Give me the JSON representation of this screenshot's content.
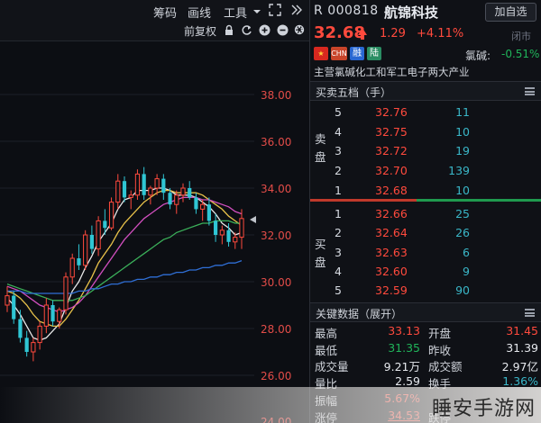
{
  "toolbar": {
    "chips_label": "筹码",
    "drawing_label": "画线",
    "tools_label": "工具",
    "adjust_label": "前复权"
  },
  "price_axis": [
    "38.00",
    "36.00",
    "34.00",
    "32.00",
    "30.00",
    "28.00",
    "26.00",
    "24.00"
  ],
  "chart_data": {
    "type": "candlestick",
    "title": "",
    "ylim": [
      24.5,
      39
    ],
    "yticks": [
      26,
      28,
      30,
      32,
      34,
      36,
      38
    ],
    "candles": [
      [
        29.0,
        29.8,
        28.7,
        29.4
      ],
      [
        29.4,
        29.6,
        28.2,
        28.4
      ],
      [
        28.4,
        28.8,
        27.4,
        27.6
      ],
      [
        27.6,
        27.9,
        26.8,
        27.0
      ],
      [
        27.0,
        27.6,
        26.6,
        27.4
      ],
      [
        27.4,
        28.3,
        27.1,
        28.1
      ],
      [
        28.1,
        29.3,
        27.8,
        29.0
      ],
      [
        29.0,
        29.2,
        28.1,
        28.3
      ],
      [
        28.3,
        28.9,
        28.0,
        28.8
      ],
      [
        28.8,
        30.4,
        28.6,
        30.2
      ],
      [
        30.2,
        31.2,
        29.9,
        31.0
      ],
      [
        31.0,
        31.6,
        30.5,
        30.7
      ],
      [
        30.7,
        32.2,
        30.5,
        32.0
      ],
      [
        32.0,
        32.4,
        31.2,
        31.4
      ],
      [
        31.4,
        32.8,
        31.1,
        32.6
      ],
      [
        32.6,
        33.1,
        32.0,
        32.3
      ],
      [
        32.3,
        33.6,
        32.2,
        33.4
      ],
      [
        33.4,
        34.6,
        33.1,
        34.3
      ],
      [
        34.3,
        34.5,
        33.4,
        33.6
      ],
      [
        33.6,
        33.9,
        33.1,
        33.7
      ],
      [
        33.7,
        34.8,
        33.5,
        34.6
      ],
      [
        34.6,
        34.9,
        33.5,
        33.7
      ],
      [
        33.7,
        34.1,
        33.3,
        34.0
      ],
      [
        34.0,
        34.6,
        33.7,
        34.4
      ],
      [
        34.4,
        34.6,
        33.5,
        33.8
      ],
      [
        33.8,
        34.0,
        33.1,
        33.3
      ],
      [
        33.3,
        33.9,
        32.9,
        33.7
      ],
      [
        33.7,
        34.2,
        33.4,
        34.0
      ],
      [
        34.0,
        34.3,
        33.5,
        33.6
      ],
      [
        33.6,
        33.8,
        32.9,
        33.1
      ],
      [
        33.1,
        33.5,
        32.6,
        33.3
      ],
      [
        33.3,
        33.6,
        32.4,
        32.6
      ],
      [
        32.6,
        32.9,
        31.7,
        32.0
      ],
      [
        32.0,
        32.4,
        31.6,
        32.2
      ],
      [
        32.2,
        32.5,
        31.5,
        31.7
      ],
      [
        31.7,
        32.1,
        31.4,
        31.9
      ],
      [
        31.9,
        33.1,
        31.4,
        32.7
      ]
    ],
    "ma_lines": [
      {
        "color": "#e8e8e8",
        "values": [
          29.3,
          29.0,
          28.6,
          28.1,
          27.6,
          27.5,
          27.6,
          27.9,
          28.2,
          28.9,
          29.6,
          30.0,
          30.6,
          31.1,
          31.7,
          32.1,
          32.5,
          33.1,
          33.5,
          33.6,
          33.9,
          33.9,
          33.9,
          34.0,
          34.0,
          33.9,
          33.7,
          33.7,
          33.7,
          33.6,
          33.4,
          33.2,
          32.9,
          32.5,
          32.3,
          32.0,
          32.1
        ]
      },
      {
        "color": "#e8c24a",
        "values": [
          29.6,
          29.5,
          29.3,
          29.0,
          28.6,
          28.3,
          28.2,
          28.1,
          28.1,
          28.4,
          28.8,
          29.2,
          29.7,
          30.2,
          30.8,
          31.2,
          31.6,
          32.1,
          32.5,
          32.8,
          33.1,
          33.4,
          33.6,
          33.8,
          33.9,
          33.9,
          33.8,
          33.8,
          33.8,
          33.8,
          33.7,
          33.5,
          33.3,
          33.1,
          32.8,
          32.6,
          32.4
        ]
      },
      {
        "color": "#d24fbf",
        "values": [
          29.8,
          29.7,
          29.6,
          29.4,
          29.2,
          29.0,
          28.9,
          28.8,
          28.7,
          28.8,
          28.9,
          29.1,
          29.4,
          29.8,
          30.2,
          30.6,
          31.0,
          31.4,
          31.8,
          32.1,
          32.4,
          32.7,
          32.9,
          33.1,
          33.3,
          33.4,
          33.5,
          33.6,
          33.6,
          33.6,
          33.5,
          33.5,
          33.4,
          33.3,
          33.2,
          33.0,
          32.9
        ]
      },
      {
        "color": "#3bb05a",
        "values": [
          29.9,
          29.8,
          29.7,
          29.6,
          29.5,
          29.4,
          29.3,
          29.2,
          29.2,
          29.2,
          29.2,
          29.3,
          29.4,
          29.6,
          29.8,
          30.0,
          30.2,
          30.4,
          30.6,
          30.8,
          31.0,
          31.2,
          31.4,
          31.6,
          31.8,
          31.9,
          32.1,
          32.2,
          32.3,
          32.4,
          32.5,
          32.5,
          32.6,
          32.6,
          32.6,
          32.5,
          32.5
        ]
      },
      {
        "color": "#2f6fd6",
        "values": [
          29.6,
          29.6,
          29.6,
          29.5,
          29.5,
          29.5,
          29.5,
          29.5,
          29.5,
          29.5,
          29.5,
          29.6,
          29.6,
          29.7,
          29.7,
          29.8,
          29.9,
          29.9,
          30.0,
          30.0,
          30.1,
          30.1,
          30.2,
          30.2,
          30.3,
          30.3,
          30.4,
          30.4,
          30.5,
          30.5,
          30.6,
          30.6,
          30.7,
          30.7,
          30.8,
          30.8,
          30.9
        ]
      }
    ]
  },
  "stock": {
    "prefix": "R",
    "code": "000818",
    "name": "航锦科技",
    "add_watch": "加自选",
    "price": "32.68",
    "change": "1.29",
    "change_pct": "+4.11%",
    "status": "闭市",
    "tags": {
      "chn": "CHN",
      "rong": "融",
      "lu": "陆"
    },
    "sector": "氯碱:",
    "sector_chg": "-0.51%",
    "business": "主营氯碱化工和军工电子两大产业"
  },
  "orderbook": {
    "title": "买卖五档（手）",
    "sell_label": [
      "卖",
      "盘"
    ],
    "buy_label": [
      "买",
      "盘"
    ],
    "asks": [
      {
        "lvl": "5",
        "px": "32.76",
        "vol": "11"
      },
      {
        "lvl": "4",
        "px": "32.75",
        "vol": "10"
      },
      {
        "lvl": "3",
        "px": "32.72",
        "vol": "19"
      },
      {
        "lvl": "2",
        "px": "32.70",
        "vol": "139"
      },
      {
        "lvl": "1",
        "px": "32.68",
        "vol": "10"
      }
    ],
    "bids": [
      {
        "lvl": "1",
        "px": "32.66",
        "vol": "25"
      },
      {
        "lvl": "2",
        "px": "32.64",
        "vol": "26"
      },
      {
        "lvl": "3",
        "px": "32.63",
        "vol": "6"
      },
      {
        "lvl": "4",
        "px": "32.60",
        "vol": "9"
      },
      {
        "lvl": "5",
        "px": "32.59",
        "vol": "90"
      }
    ]
  },
  "keydata": {
    "title": "关键数据（展开）",
    "rows": [
      {
        "l1": "最高",
        "v1": "33.13",
        "l2": "开盘",
        "v2": "31.45"
      },
      {
        "l1": "最低",
        "v1": "31.35",
        "l2": "昨收",
        "v2": "31.39"
      },
      {
        "l1": "成交量",
        "v1": "9.21万",
        "l2": "成交额",
        "v2": "2.97亿"
      },
      {
        "l1": "量比",
        "v1": "2.59",
        "l2": "换手",
        "v2": "1.36%"
      },
      {
        "l1": "振幅",
        "v1": "5.67%",
        "l2": "",
        "v2": ""
      },
      {
        "l1": "涨停",
        "v1": "34.53",
        "l2": "跌停",
        "v2": ""
      }
    ]
  },
  "watermark": "睡安手游网"
}
